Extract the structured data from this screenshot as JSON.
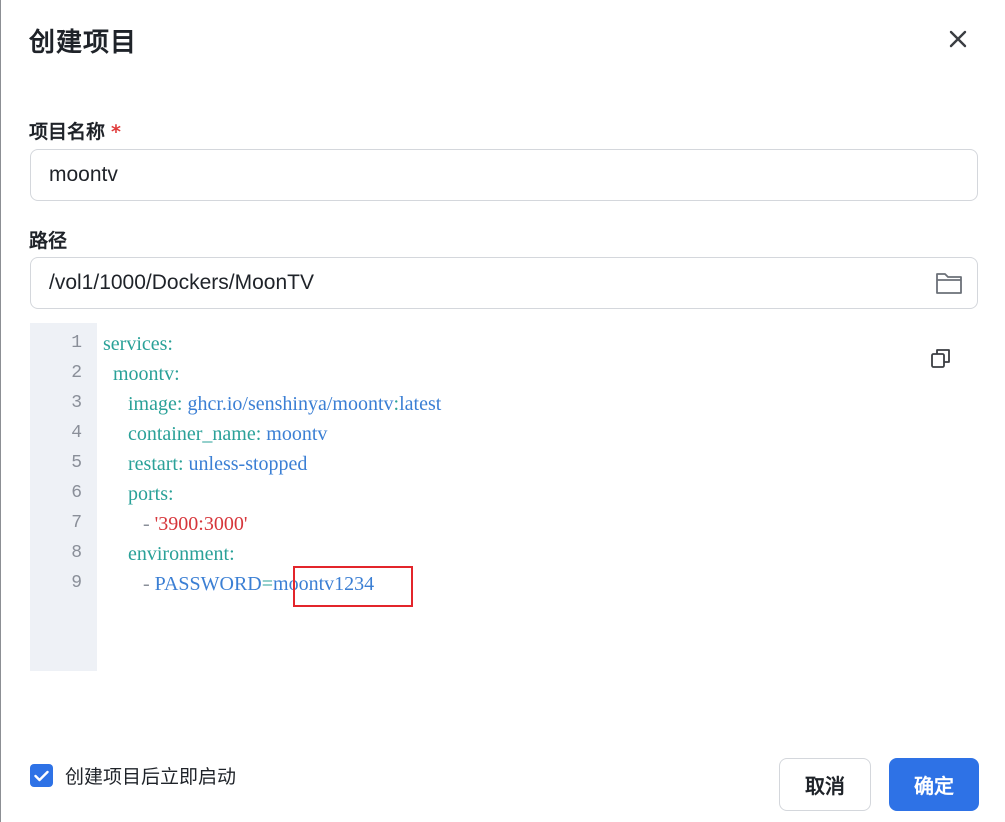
{
  "dialog": {
    "title": "创建项目"
  },
  "form": {
    "name_label": "项目名称",
    "required_mark": "*",
    "name_value": "moontv",
    "path_label": "路径",
    "path_value": "/vol1/1000/Dockers/MoonTV"
  },
  "editor": {
    "line_numbers": [
      "1",
      "2",
      "3",
      "4",
      "5",
      "6",
      "7",
      "8",
      "9"
    ],
    "lines": [
      [
        {
          "t": "services",
          "c": "k"
        },
        {
          "t": ":",
          "c": "p"
        }
      ],
      [
        {
          "t": "  moontv",
          "c": "k"
        },
        {
          "t": ":",
          "c": "p"
        }
      ],
      [
        {
          "t": "     image",
          "c": "k"
        },
        {
          "t": ": ",
          "c": "p"
        },
        {
          "t": "ghcr.io/senshinya/moontv",
          "c": "v"
        },
        {
          "t": ":",
          "c": "p"
        },
        {
          "t": "latest",
          "c": "v"
        }
      ],
      [
        {
          "t": "     container_name",
          "c": "k"
        },
        {
          "t": ": ",
          "c": "p"
        },
        {
          "t": "moontv",
          "c": "v"
        }
      ],
      [
        {
          "t": "     restart",
          "c": "k"
        },
        {
          "t": ": ",
          "c": "p"
        },
        {
          "t": "unless-stopped",
          "c": "v"
        }
      ],
      [
        {
          "t": "     ports",
          "c": "k"
        },
        {
          "t": ":",
          "c": "p"
        }
      ],
      [
        {
          "t": "        - ",
          "c": "d"
        },
        {
          "t": "'3900:3000'",
          "c": "s"
        }
      ],
      [
        {
          "t": "     environment",
          "c": "k"
        },
        {
          "t": ":",
          "c": "p"
        }
      ],
      [
        {
          "t": "        - ",
          "c": "d"
        },
        {
          "t": "PASSWORD",
          "c": "v"
        },
        {
          "t": "=",
          "c": "p"
        },
        {
          "t": "moontv1234",
          "c": "v"
        }
      ]
    ]
  },
  "footer": {
    "autostart_checked": true,
    "autostart_label": "创建项目后立即启动",
    "cancel_label": "取消",
    "confirm_label": "确定"
  },
  "colors": {
    "accent": "#2e72e6",
    "required": "#e03a3a",
    "highlight": "#e3252b"
  }
}
